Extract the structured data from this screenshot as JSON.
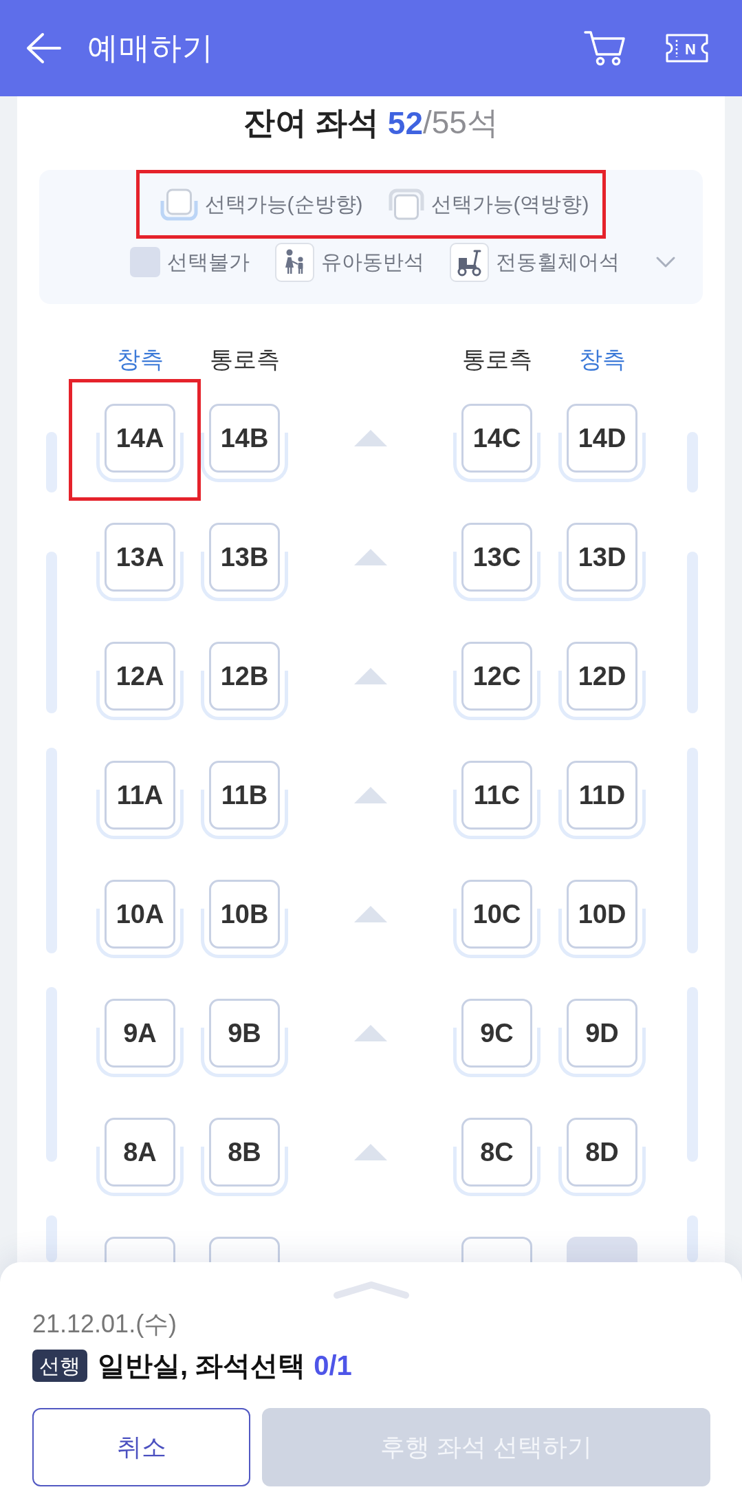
{
  "app_bar": {
    "title": "예매하기",
    "actions": [
      {
        "kind": "cart"
      },
      {
        "kind": "ticket",
        "label": "N"
      }
    ]
  },
  "seat_summary": {
    "label": "잔여 좌석",
    "remaining": "52",
    "total": "/55석"
  },
  "legend": {
    "expanded": false,
    "rows": [
      {
        "highlighted": true,
        "items": [
          {
            "kind": "forward",
            "label": "선택가능(순방향)"
          },
          {
            "kind": "reverse",
            "label": "선택가능(역방향)"
          }
        ]
      },
      {
        "highlighted": false,
        "items": [
          {
            "kind": "unavailable",
            "label": "선택불가"
          },
          {
            "kind": "child",
            "label": "유아동반석"
          },
          {
            "kind": "wheelchair",
            "label": "전동휠체어석"
          }
        ]
      }
    ]
  },
  "seat_map": {
    "columns": [
      {
        "kind": "window",
        "label": "창측"
      },
      {
        "kind": "aisle",
        "label": "통로측"
      },
      {
        "kind": "aisle",
        "label": "통로측"
      },
      {
        "kind": "window",
        "label": "창측"
      }
    ],
    "rows": [
      {
        "seats": [
          {
            "label": "14A",
            "kind": "forward",
            "highlighted": true
          },
          {
            "label": "14B",
            "kind": "forward",
            "highlighted": false
          },
          {
            "label": "14C",
            "kind": "forward",
            "highlighted": false
          },
          {
            "label": "14D",
            "kind": "forward",
            "highlighted": false
          }
        ]
      },
      {
        "seats": [
          {
            "label": "13A",
            "kind": "forward",
            "highlighted": false
          },
          {
            "label": "13B",
            "kind": "forward",
            "highlighted": false
          },
          {
            "label": "13C",
            "kind": "forward",
            "highlighted": false
          },
          {
            "label": "13D",
            "kind": "forward",
            "highlighted": false
          }
        ]
      },
      {
        "seats": [
          {
            "label": "12A",
            "kind": "forward",
            "highlighted": false
          },
          {
            "label": "12B",
            "kind": "forward",
            "highlighted": false
          },
          {
            "label": "12C",
            "kind": "forward",
            "highlighted": false
          },
          {
            "label": "12D",
            "kind": "forward",
            "highlighted": false
          }
        ]
      },
      {
        "seats": [
          {
            "label": "11A",
            "kind": "forward",
            "highlighted": false
          },
          {
            "label": "11B",
            "kind": "forward",
            "highlighted": false
          },
          {
            "label": "11C",
            "kind": "forward",
            "highlighted": false
          },
          {
            "label": "11D",
            "kind": "forward",
            "highlighted": false
          }
        ]
      },
      {
        "seats": [
          {
            "label": "10A",
            "kind": "forward",
            "highlighted": false
          },
          {
            "label": "10B",
            "kind": "forward",
            "highlighted": false
          },
          {
            "label": "10C",
            "kind": "forward",
            "highlighted": false
          },
          {
            "label": "10D",
            "kind": "forward",
            "highlighted": false
          }
        ]
      },
      {
        "seats": [
          {
            "label": "9A",
            "kind": "forward",
            "highlighted": false
          },
          {
            "label": "9B",
            "kind": "forward",
            "highlighted": false
          },
          {
            "label": "9C",
            "kind": "forward",
            "highlighted": false
          },
          {
            "label": "9D",
            "kind": "forward",
            "highlighted": false
          }
        ]
      },
      {
        "seats": [
          {
            "label": "8A",
            "kind": "forward",
            "highlighted": false
          },
          {
            "label": "8B",
            "kind": "forward",
            "highlighted": false
          },
          {
            "label": "8C",
            "kind": "forward",
            "highlighted": false
          },
          {
            "label": "8D",
            "kind": "forward",
            "highlighted": false
          }
        ]
      }
    ],
    "cut_off_row": {
      "seats": [
        {
          "kind": "forward"
        },
        {
          "kind": "forward"
        },
        {
          "kind": "forward"
        },
        {
          "kind": "unavailable"
        }
      ]
    }
  },
  "bottom_sheet": {
    "date": "21.12.01.(수)",
    "badge": "선행",
    "summary": "일반실, 좌석선택",
    "count": "0/1",
    "buttons": [
      {
        "kind": "outline",
        "label": "취소",
        "disabled": false
      },
      {
        "kind": "filled",
        "label": "후행 좌석 선택하기",
        "disabled": true
      }
    ]
  }
}
